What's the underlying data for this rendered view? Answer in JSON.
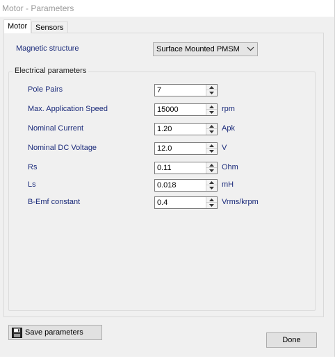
{
  "window": {
    "title": "Motor - Parameters"
  },
  "tabs": [
    {
      "label": "Motor",
      "active": true
    },
    {
      "label": "Sensors",
      "active": false
    }
  ],
  "magnetic": {
    "label": "Magnetic structure",
    "selected": "Surface Mounted PMSM"
  },
  "electrical": {
    "title": "Electrical parameters",
    "rows": [
      {
        "label": "Pole Pairs",
        "value": "7",
        "unit": ""
      },
      {
        "label": "Max. Application Speed",
        "value": "15000",
        "unit": "rpm"
      },
      {
        "label": "Nominal Current",
        "value": "1.20",
        "unit": "Apk"
      },
      {
        "label": "Nominal DC Voltage",
        "value": "12.0",
        "unit": "V"
      },
      {
        "label": "Rs",
        "value": "0.11",
        "unit": "Ohm"
      },
      {
        "label": "Ls",
        "value": "0.018",
        "unit": "mH"
      },
      {
        "label": "B-Emf constant",
        "value": "0.4",
        "unit": "Vrms/krpm"
      }
    ]
  },
  "buttons": {
    "save": "Save parameters",
    "done": "Done"
  },
  "icons": {
    "save": "floppy-disk-icon",
    "chevron": "chevron-down-icon"
  }
}
